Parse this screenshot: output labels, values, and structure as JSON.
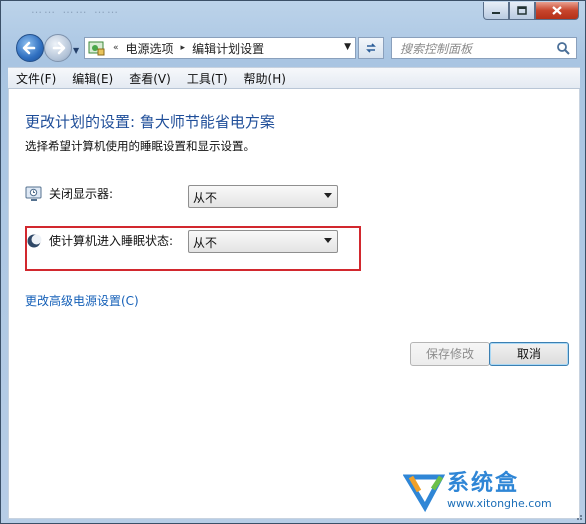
{
  "window": {
    "ghost_title": "…… …… ……",
    "caption_buttons": {
      "minimize_icon": "minimize-icon",
      "maximize_icon": "maximize-icon",
      "close_icon": "close-icon"
    }
  },
  "address": {
    "crumbs": [
      "电源选项",
      "编辑计划设置"
    ],
    "leading_separator": "«",
    "separator": "▸"
  },
  "search": {
    "placeholder": "搜索控制面板"
  },
  "menu": {
    "items": [
      "文件(F)",
      "编辑(E)",
      "查看(V)",
      "工具(T)",
      "帮助(H)"
    ]
  },
  "page": {
    "heading": "更改计划的设置: 鲁大师节能省电方案",
    "description": "选择希望计算机使用的睡眠设置和显示设置。",
    "display_off": {
      "label": "关闭显示器:",
      "value": "从不",
      "icon": "monitor-icon"
    },
    "sleep": {
      "label": "使计算机进入睡眠状态:",
      "value": "从不",
      "icon": "moon-icon"
    },
    "advanced_link": "更改高级电源设置(C)",
    "save_button": "保存修改",
    "cancel_button": "取消"
  },
  "watermark": {
    "brand": "系统盒",
    "url": "www.xitonghe.com"
  },
  "colors": {
    "heading": "#1f4e99",
    "link": "#1560b8",
    "highlight_box": "#d2282e",
    "close_button": "#c7452c"
  }
}
